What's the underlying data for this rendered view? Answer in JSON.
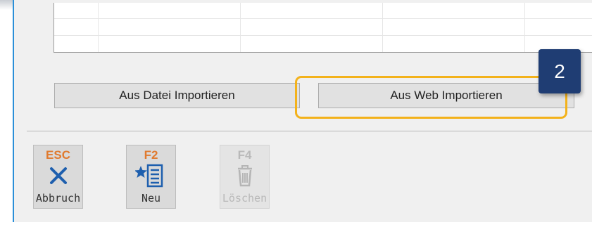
{
  "import_buttons": {
    "file_label": "Aus Datei Importieren",
    "web_label": "Aus Web Importieren"
  },
  "callout": {
    "number": "2",
    "color": "#1f3d73",
    "highlight_color": "#f3b21b"
  },
  "toolbar": {
    "cancel": {
      "key": "ESC",
      "label": "Abbruch",
      "icon": "close-icon"
    },
    "new": {
      "key": "F2",
      "label": "Neu",
      "icon": "new-list-icon"
    },
    "delete": {
      "key": "F4",
      "label": "Löschen",
      "icon": "trash-icon",
      "disabled": true
    }
  }
}
